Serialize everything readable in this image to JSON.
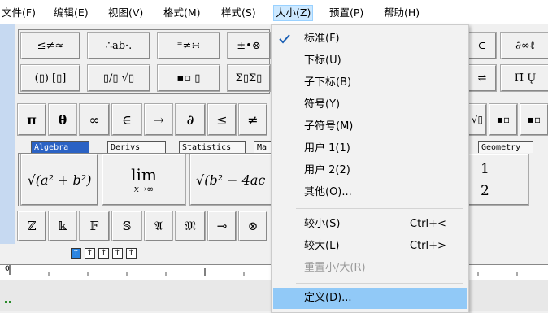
{
  "menubar": {
    "items": [
      {
        "label": "文件(F)"
      },
      {
        "label": "编辑(E)"
      },
      {
        "label": "视图(V)"
      },
      {
        "label": "格式(M)"
      },
      {
        "label": "样式(S)"
      },
      {
        "label": "大小(Z)"
      },
      {
        "label": "预置(P)"
      },
      {
        "label": "帮助(H)"
      }
    ]
  },
  "palette": {
    "row1": [
      "≤≠≈",
      "∴ab·.",
      "⁼≠∺",
      "±•⊗",
      "⊂",
      "∂∞ℓ"
    ],
    "row2": [
      "(▯) [▯]",
      "▯/▯ √▯",
      "▪▫ ▯",
      "Σ▯Σ▯",
      "⇌",
      "Π̄ Ų"
    ],
    "row3": [
      "π",
      "θ",
      "∞",
      "∈",
      "→",
      "∂",
      "≤",
      "≠",
      "√▯",
      "▪▫",
      "▪▫"
    ],
    "tabs": [
      {
        "label": "Algebra",
        "selected": true
      },
      {
        "label": "Derivs"
      },
      {
        "label": "Statistics"
      },
      {
        "label": "Ma"
      },
      {
        "label": "Geometry"
      }
    ],
    "templates": {
      "sqrt_a": "√(a² + b²)",
      "lim_main": "lim",
      "lim_sub": "x→∞",
      "sqrt_b": "√(b² − 4ac",
      "frac_num": "1",
      "frac_den": "2"
    },
    "row5": [
      "ℤ",
      "𝕜",
      "𝔽",
      "𝕊",
      "𝔄",
      "𝔐",
      "⊸",
      "⊗"
    ],
    "size_buttons": [
      "↑",
      "↑",
      "↑",
      "↑",
      "↑"
    ]
  },
  "ruler": {
    "zero_label": "0"
  },
  "dropdown": {
    "checked_index": 0,
    "items": [
      {
        "label": "标准(F)",
        "checked": true
      },
      {
        "label": "下标(U)"
      },
      {
        "label": "子下标(B)"
      },
      {
        "label": "符号(Y)"
      },
      {
        "label": "子符号(M)"
      },
      {
        "label": "用户 1(1)"
      },
      {
        "label": "用户 2(2)"
      },
      {
        "label": "其他(O)..."
      },
      {
        "label": "较小(S)",
        "shortcut": "Ctrl+<"
      },
      {
        "label": "较大(L)",
        "shortcut": "Ctrl+>"
      },
      {
        "label": "重置小/大(R)",
        "disabled": true
      },
      {
        "label": "定义(D)...",
        "highlighted": true
      }
    ]
  },
  "colors": {
    "accent": "#2b62c4",
    "highlight": "#91c9f7",
    "menu_active": "#cce8ff"
  }
}
